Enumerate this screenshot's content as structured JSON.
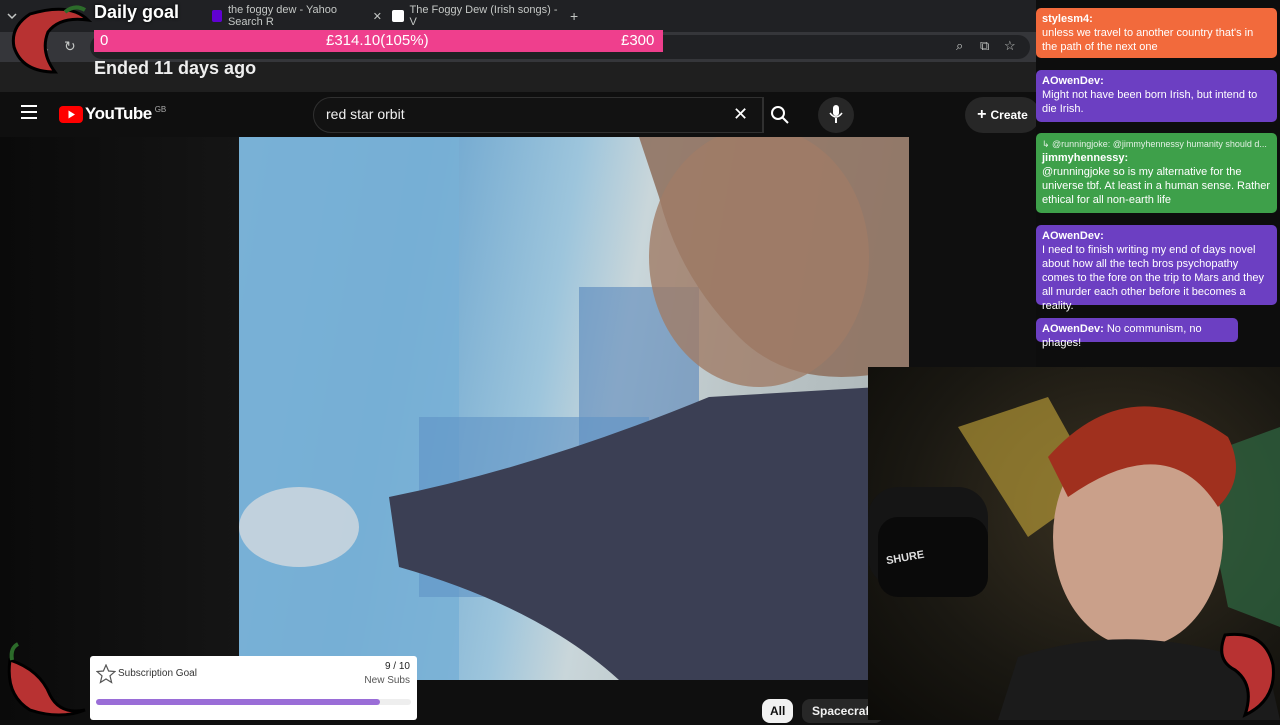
{
  "browser": {
    "tabs": [
      {
        "title": "the foggy dew - Yahoo Search R",
        "favicon_color": "#6001d2"
      },
      {
        "title": "The Foggy Dew (Irish songs) - V",
        "favicon_color": "#ffffff"
      }
    ],
    "new_tab_label": "+",
    "close_label": "✕"
  },
  "youtube": {
    "logo_text": "YouTube",
    "region": "GB",
    "search_value": "red star orbit",
    "create_label": "Create",
    "chips": [
      "All",
      "Spacecraft"
    ]
  },
  "goal_overlay": {
    "title": "Daily goal",
    "start": "0",
    "current": "£314.10(105%)",
    "target": "£300",
    "ended": "Ended 11 days ago",
    "bar_color": "#ef3f8d"
  },
  "chat": [
    {
      "user": "stylesm4:",
      "text": "unless we travel to another country that's in the path of the next one",
      "color": "#f26a3c"
    },
    {
      "user": "AOwenDev:",
      "text": "Might not have been born Irish, but intend to die Irish.",
      "color": "#6c3fc2"
    },
    {
      "reply": "↳ @runningjoke: @jimmyhennessy humanity should d...",
      "user": "jimmyhennessy:",
      "text": "@runningjoke so is my alternative for the universe tbf. At least in a human sense. Rather ethical for all non-earth life",
      "color": "#3ea04a"
    },
    {
      "user": "AOwenDev:",
      "text": "I need to finish writing my end of days novel about how all the tech bros psychopathy comes to the fore on the trip to Mars and they all murder each other before it becomes a reality.",
      "color": "#6c3fc2"
    },
    {
      "user": "AOwenDev:",
      "text": "No communism, no phages!",
      "color": "#6c3fc2"
    }
  ],
  "sub_goal": {
    "title": "Subscription Goal",
    "count": "9 / 10",
    "label": "New Subs",
    "progress": 0.9,
    "bar_color": "#9a6dd7"
  },
  "mic_brand": "SHURE"
}
